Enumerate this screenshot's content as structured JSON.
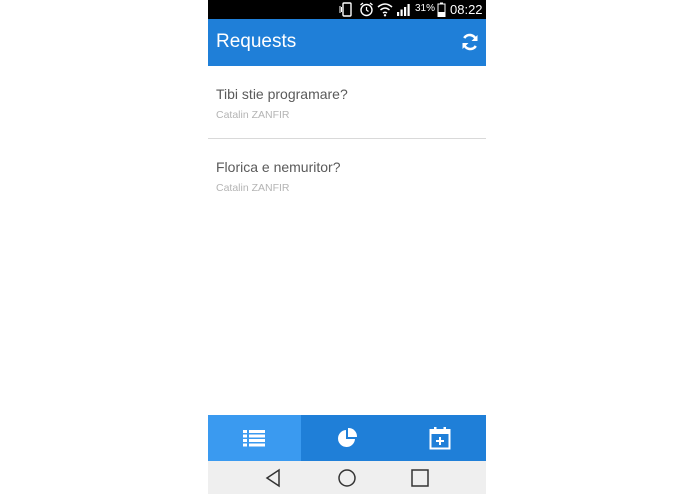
{
  "status_bar": {
    "battery_percent": "31%",
    "time": "08:22",
    "icons": [
      "vibrate-icon",
      "alarm-icon",
      "wifi-icon",
      "signal-icon",
      "battery-icon"
    ]
  },
  "app_bar": {
    "title": "Requests",
    "action_icon": "refresh-icon",
    "background": "#1f7fd8"
  },
  "requests": [
    {
      "title": "Tibi stie programare?",
      "author": "Catalin ZANFIR"
    },
    {
      "title": "Florica e nemuritor?",
      "author": "Catalin ZANFIR"
    }
  ],
  "tabs": [
    {
      "icon": "list-icon",
      "active": true
    },
    {
      "icon": "pie-chart-icon",
      "active": false
    },
    {
      "icon": "calendar-add-icon",
      "active": false
    }
  ],
  "nav_bar": {
    "buttons": [
      "back-icon",
      "home-icon",
      "recents-icon"
    ]
  },
  "colors": {
    "accent": "#1f7fd8",
    "accent_active_tab": "#3a9af0",
    "title_text": "#5a5a5a",
    "subtitle_text": "#b4b4b4"
  }
}
